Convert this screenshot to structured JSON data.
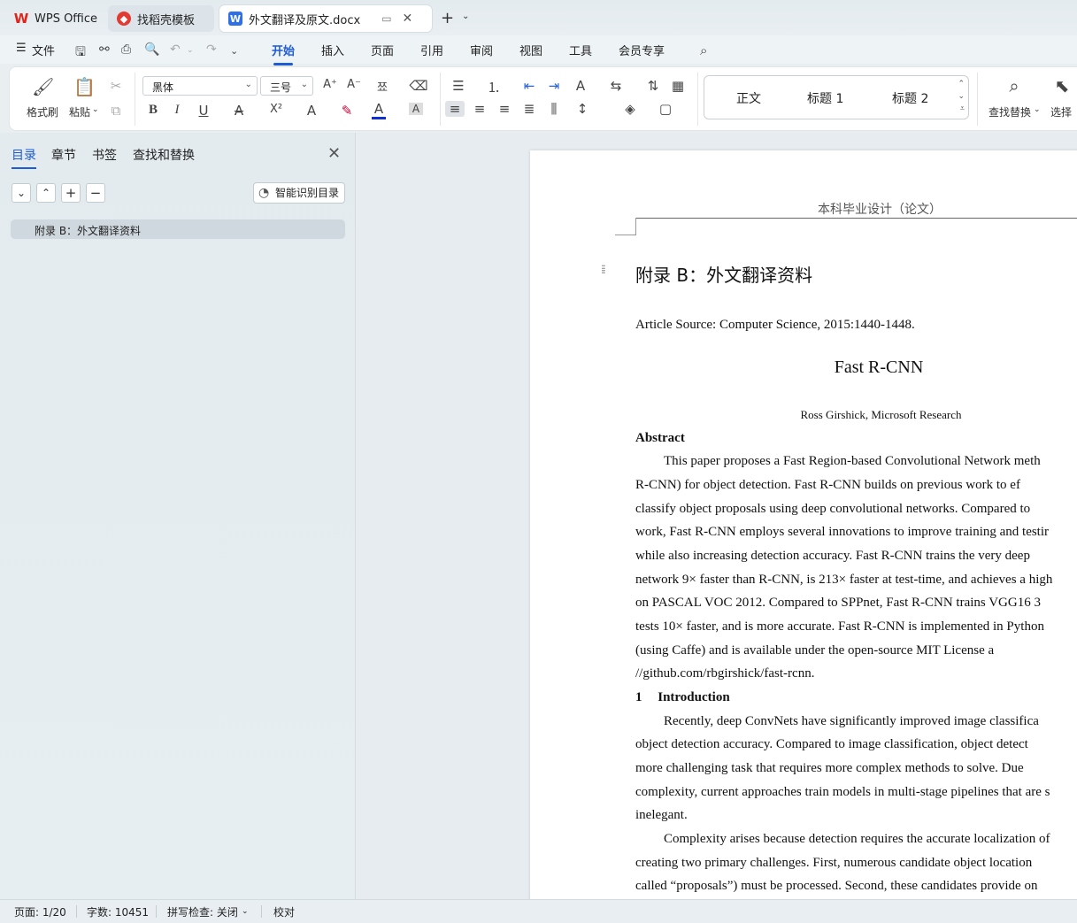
{
  "tabs": [
    {
      "label": "WPS Office",
      "icon": "wps-logo-icon"
    },
    {
      "label": "找稻壳模板",
      "icon": "docer-icon"
    },
    {
      "label": "外文翻译及原文.docx",
      "icon": "word-doc-icon"
    }
  ],
  "menu": {
    "file": "文件",
    "items": [
      "开始",
      "插入",
      "页面",
      "引用",
      "审阅",
      "视图",
      "工具",
      "会员专享"
    ],
    "active": "开始"
  },
  "ribbon": {
    "format_painter": "格式刷",
    "paste": "粘贴",
    "font_name": "黑体",
    "font_size": "三号",
    "styles": [
      "正文",
      "标题 1",
      "标题 2"
    ],
    "find_replace": "查找替换",
    "select": "选择"
  },
  "nav_panel": {
    "tabs": [
      "目录",
      "章节",
      "书签",
      "查找和替换"
    ],
    "active_tab": "目录",
    "smart_toc_button": "智能识别目录",
    "toc_items": [
      "附录 B：外文翻译资料"
    ]
  },
  "document": {
    "header": "本科毕业设计（论文）",
    "heading": "附录 B：外文翻译资料",
    "source": "Article Source: Computer Science, 2015:1440-1448.",
    "paper_title": "Fast R-CNN",
    "author": "Ross Girshick, Microsoft Research",
    "abstract_heading": "Abstract",
    "abstract_lines": [
      "This paper proposes a Fast Region-based Convolutional Network meth",
      "R-CNN)  for  object  detection.  Fast  R-CNN  builds  on  previous  work  to  ef",
      "classify  object  proposals  using  deep  convolutional  networks.  Compared  to",
      "work, Fast R-CNN employs several innovations to improve training and testir",
      "while  also  increasing  detection  accuracy.  Fast  R-CNN  trains  the  very  deep",
      "network 9× faster than R-CNN, is 213× faster at test-time, and achieves a high",
      "on PASCAL VOC 2012. Compared to SPPnet, Fast R-CNN trains VGG16 3",
      "tests 10× faster, and is more accurate. Fast R-CNN is implemented in Python",
      "(using  Caffe)  and  is  available  under  the  open-source  MIT  License  a",
      "//github.com/rbgirshick/fast-rcnn."
    ],
    "section_number": "1",
    "section_title": "Introduction",
    "intro_lines": [
      "Recently,  deep  ConvNets  have  significantly  improved  image  classifica",
      "object  detection  accuracy.  Compared  to  image  classification,  object  detect",
      "more  challenging  task  that  requires  more  complex  methods  to  solve.  Due",
      "complexity, current approaches train models in multi-stage pipelines that are s",
      "inelegant.",
      "Complexity arises because detection requires the accurate localization of",
      "creating  two  primary  challenges.  First,  numerous  candidate  object  location",
      "called “proposals”) must be processed. Second, these candidates provide on"
    ]
  },
  "status": {
    "page": "页面: 1/20",
    "words": "字数: 10451",
    "spellcheck": "拼写检查: 关闭",
    "proofread": "校对"
  }
}
